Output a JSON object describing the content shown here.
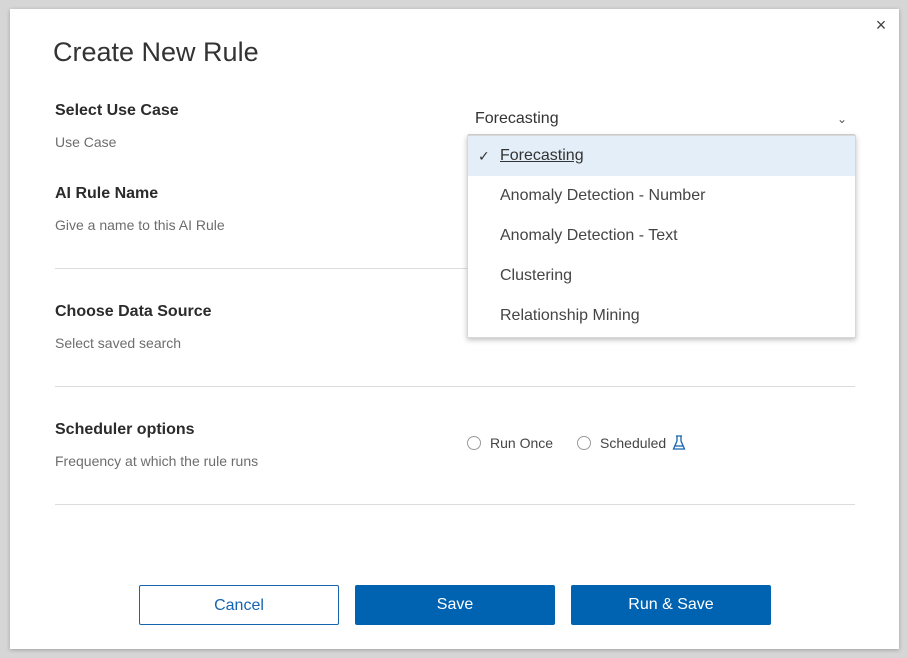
{
  "dialog": {
    "title": "Create New Rule",
    "close_symbol": "×"
  },
  "use_case": {
    "label": "Select Use Case",
    "description": "Use Case",
    "selected_value": "Forecasting",
    "options": [
      "Forecasting",
      "Anomaly Detection - Number",
      "Anomaly Detection - Text",
      "Clustering",
      "Relationship Mining"
    ]
  },
  "rule_name": {
    "label": "AI Rule Name",
    "description": "Give a name to this AI Rule"
  },
  "data_source": {
    "label": "Choose Data Source",
    "description": "Select saved search"
  },
  "scheduler": {
    "label": "Scheduler options",
    "description": "Frequency at which the rule runs",
    "options": [
      "Run Once",
      "Scheduled"
    ]
  },
  "buttons": {
    "cancel": "Cancel",
    "save": "Save",
    "run_save": "Run & Save"
  },
  "colors": {
    "primary": "#0063b1",
    "selected_option_bg": "#e4eef8"
  },
  "icons": {
    "close": "close-icon",
    "chevron": "chevron-down-icon",
    "check": "check-icon",
    "flask": "flask-icon"
  }
}
